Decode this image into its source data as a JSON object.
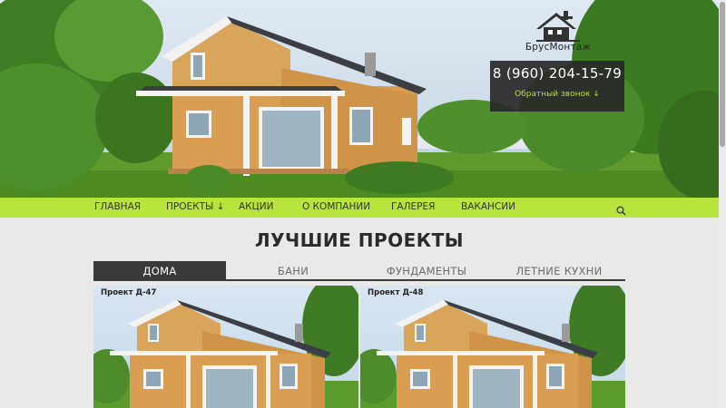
{
  "brand": {
    "logo_text": "БрусМонтаж"
  },
  "contact": {
    "phone": "8 (960) 204-15-79",
    "callback_label": "Обратный звонок ↓"
  },
  "nav": {
    "items": [
      "ГЛАВНАЯ",
      "ПРОЕКТЫ ↓",
      "АКЦИИ",
      "О КОМПАНИИ",
      "ГАЛЕРЕЯ",
      "ВАКАНСИИ"
    ],
    "search_icon": "search-icon"
  },
  "projects": {
    "title": "ЛУЧШИЕ ПРОЕКТЫ",
    "tabs": [
      "ДОМА",
      "БАНИ",
      "ФУНДАМЕНТЫ",
      "ЛЕТНИЕ КУХНИ"
    ],
    "active_tab": "ДОМА",
    "cards": [
      {
        "title": "Проект Д-47"
      },
      {
        "title": "Проект Д-48"
      }
    ]
  },
  "colors": {
    "accent": "#b8e53b",
    "dark": "#3a3a3a",
    "callback": "#b6e23a"
  }
}
